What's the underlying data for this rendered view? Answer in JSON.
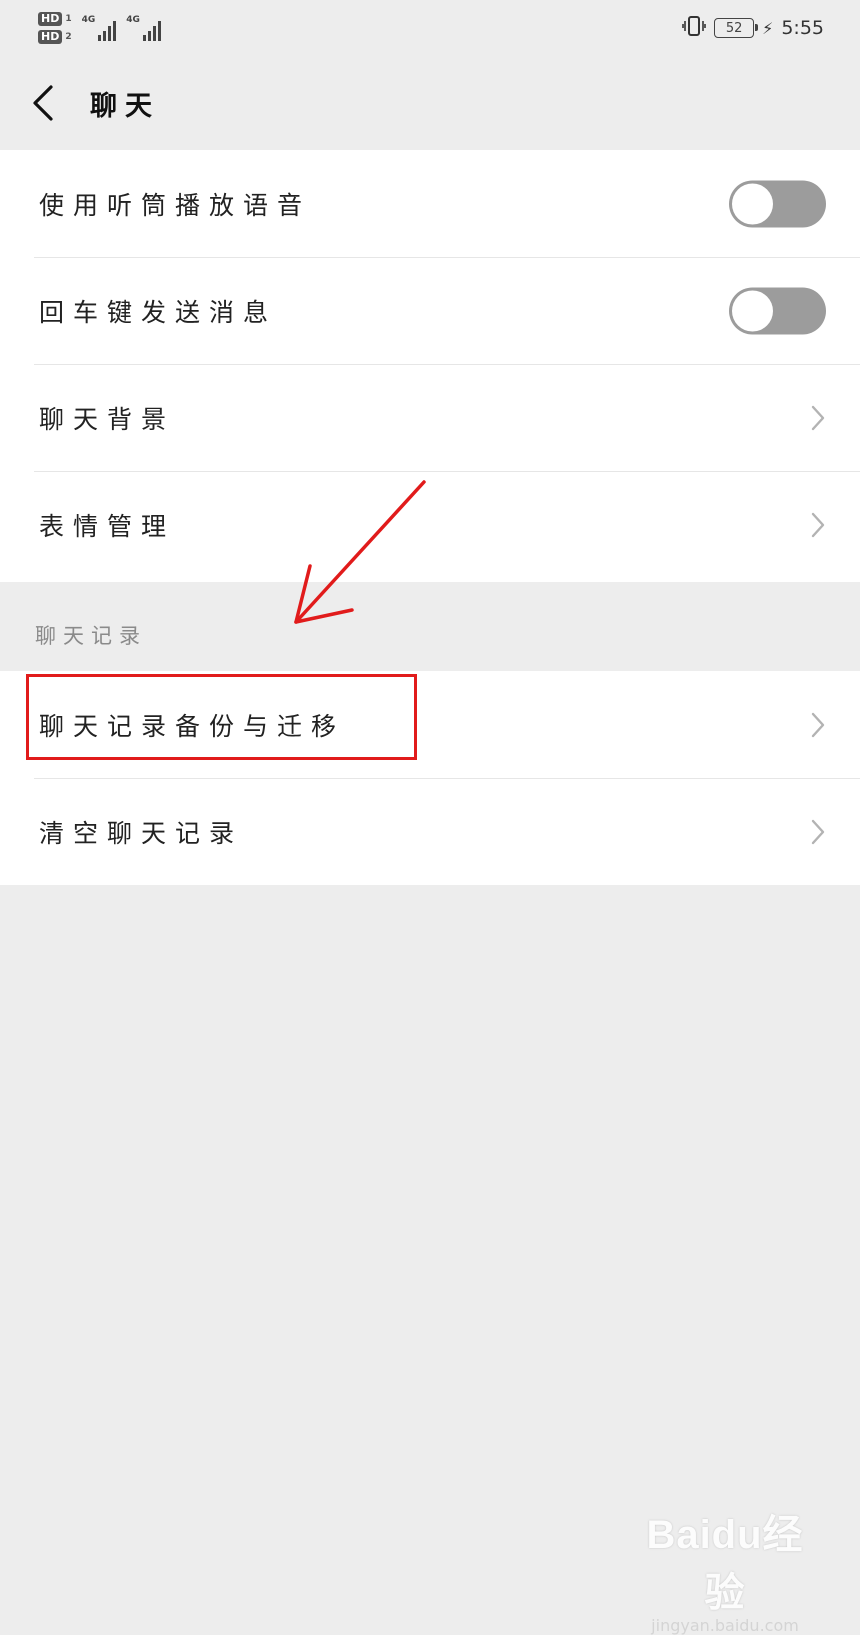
{
  "status_bar": {
    "hd_label": "HD",
    "sim1": "1",
    "sim2": "2",
    "network1": "4G",
    "network2": "4G",
    "battery": "52",
    "time": "5:55"
  },
  "nav": {
    "title": "聊天"
  },
  "settings_group_1": [
    {
      "label": "使用听筒播放语音",
      "control": "toggle",
      "on": false
    },
    {
      "label": "回车键发送消息",
      "control": "toggle",
      "on": false
    },
    {
      "label": "聊天背景",
      "control": "chevron"
    },
    {
      "label": "表情管理",
      "control": "chevron"
    }
  ],
  "chat_history_section": {
    "title": "聊天记录",
    "items": [
      {
        "label": "聊天记录备份与迁移",
        "control": "chevron"
      },
      {
        "label": "清空聊天记录",
        "control": "chevron"
      }
    ]
  },
  "watermark": {
    "brand": "Baidu经验",
    "url": "jingyan.baidu.com"
  },
  "colors": {
    "background": "#ededed",
    "card": "#ffffff",
    "toggle_off": "#9c9c9c",
    "annotation_red": "#e11b1b"
  }
}
